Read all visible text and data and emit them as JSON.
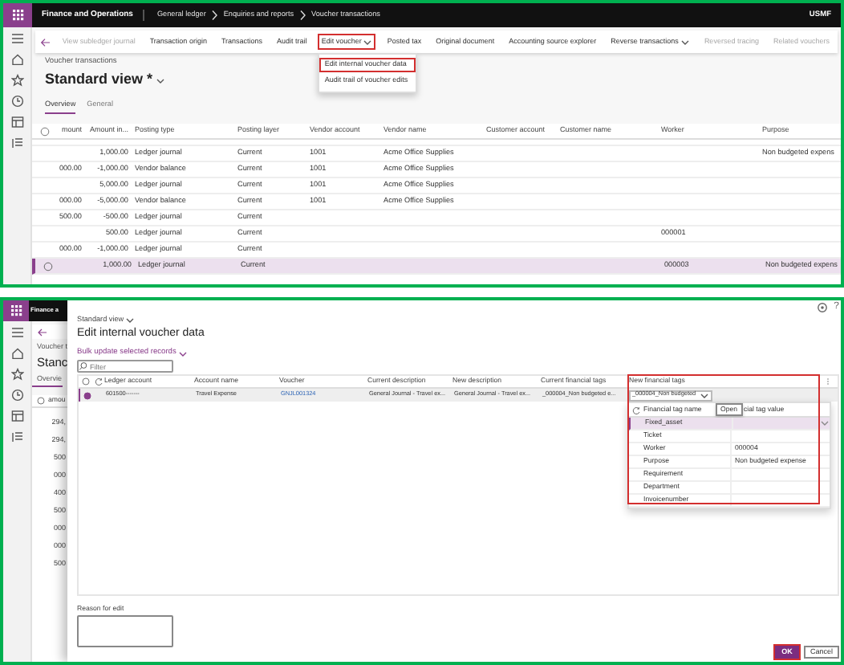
{
  "top_window": {
    "app_title": "Finance and Operations",
    "breadcrumb": [
      "General ledger",
      "Enquiries and reports",
      "Voucher transactions"
    ],
    "company": "USMF",
    "actions": [
      {
        "label": "View subledger journal",
        "disabled": true,
        "dropdown": false,
        "highlighted": false
      },
      {
        "label": "Transaction origin",
        "disabled": false,
        "dropdown": false,
        "highlighted": false
      },
      {
        "label": "Transactions",
        "disabled": false,
        "dropdown": false,
        "highlighted": false
      },
      {
        "label": "Audit trail",
        "disabled": false,
        "dropdown": false,
        "highlighted": false
      },
      {
        "label": "Edit voucher",
        "disabled": false,
        "dropdown": true,
        "highlighted": true,
        "menu": [
          {
            "label": "Edit internal voucher data",
            "highlighted": true
          },
          {
            "label": "Audit trail of voucher edits",
            "highlighted": false
          }
        ]
      },
      {
        "label": "Posted tax",
        "disabled": false,
        "dropdown": false,
        "highlighted": false
      },
      {
        "label": "Original document",
        "disabled": false,
        "dropdown": false,
        "highlighted": false
      },
      {
        "label": "Accounting source explorer",
        "disabled": false,
        "dropdown": false,
        "highlighted": false
      },
      {
        "label": "Reverse transactions",
        "disabled": false,
        "dropdown": true,
        "highlighted": false
      },
      {
        "label": "Reversed tracing",
        "disabled": true,
        "dropdown": false,
        "highlighted": false
      },
      {
        "label": "Related vouchers",
        "disabled": true,
        "dropdown": false,
        "highlighted": false
      }
    ],
    "caption": "Voucher transactions",
    "title": "Standard view *",
    "tabs": [
      {
        "label": "Overview",
        "selected": true
      },
      {
        "label": "General",
        "selected": false
      }
    ],
    "grid": {
      "all_selected": false,
      "columns": [
        {
          "label": "mount",
          "kind": "amount"
        },
        {
          "label": "Amount in...",
          "kind": "amount"
        },
        {
          "label": "Posting type",
          "kind": "text"
        },
        {
          "label": "Posting layer",
          "kind": "text"
        },
        {
          "label": "Vendor account",
          "kind": "text"
        },
        {
          "label": "Vendor name",
          "kind": "text"
        },
        {
          "label": "Customer account",
          "kind": "text"
        },
        {
          "label": "Customer name",
          "kind": "text"
        },
        {
          "label": "Worker",
          "kind": "text"
        },
        {
          "label": "Purpose",
          "kind": "text"
        }
      ],
      "rows": [
        {
          "selected": false,
          "amount_in": "1,000.00",
          "posting_type": "Ledger journal",
          "posting_layer": "Current",
          "vendor_account": "1001",
          "vendor_name": "Acme Office Supplies",
          "purpose": "Non budgeted expens"
        },
        {
          "selected": false,
          "amount": "000.00",
          "amount_in": "-1,000.00",
          "posting_type": "Vendor balance",
          "posting_layer": "Current",
          "vendor_account": "1001",
          "vendor_name": "Acme Office Supplies"
        },
        {
          "selected": false,
          "amount_in": "5,000.00",
          "posting_type": "Ledger journal",
          "posting_layer": "Current",
          "vendor_account": "1001",
          "vendor_name": "Acme Office Supplies"
        },
        {
          "selected": false,
          "amount": "000.00",
          "amount_in": "-5,000.00",
          "posting_type": "Vendor balance",
          "posting_layer": "Current",
          "vendor_account": "1001",
          "vendor_name": "Acme Office Supplies"
        },
        {
          "selected": false,
          "amount": "500.00",
          "amount_in": "-500.00",
          "posting_type": "Ledger journal",
          "posting_layer": "Current"
        },
        {
          "selected": false,
          "amount_in": "500.00",
          "posting_type": "Ledger journal",
          "posting_layer": "Current",
          "worker": "000001"
        },
        {
          "selected": false,
          "amount": "000.00",
          "amount_in": "-1,000.00",
          "posting_type": "Ledger journal",
          "posting_layer": "Current"
        },
        {
          "selected": true,
          "amount_in": "1,000.00",
          "posting_type": "Ledger journal",
          "posting_layer": "Current",
          "worker": "000003",
          "purpose": "Non budgeted expens"
        }
      ]
    }
  },
  "background_page": {
    "app_title": "Finance a",
    "caption": "Voucher t",
    "title": "Stanc",
    "tab": "Overvie",
    "all_selected": false,
    "column": "amou",
    "amounts": [
      "294,",
      "294,",
      "500",
      "000",
      "400",
      "500",
      "000",
      "000",
      "500"
    ]
  },
  "dialog": {
    "help": "?",
    "view": "Standard view",
    "title": "Edit internal voucher data",
    "bulk_action": "Bulk update selected records",
    "filter": {
      "placeholder": "Filter"
    },
    "all_selected": false,
    "columns": [
      {
        "label": "Ledger account",
        "kind": "text"
      },
      {
        "label": "Account name",
        "kind": "text"
      },
      {
        "label": "Voucher",
        "kind": "link"
      },
      {
        "label": "Current description",
        "kind": "text"
      },
      {
        "label": "New description",
        "kind": "text"
      },
      {
        "label": "Current financial tags",
        "kind": "text"
      },
      {
        "label": "New financial tags",
        "kind": "dropdown"
      }
    ],
    "highlight_tags_column": true,
    "rows": [
      {
        "selected": true,
        "ledger_account": "601500-------",
        "account_name": "Travel Expense",
        "voucher": "GNJL001324",
        "current_description": "General Journal - Travel ex...",
        "new_description": "General Journal - Travel ex...",
        "current_tags": "_000004_Non budgeted e...",
        "new_tags": "_000004_Non budgeted"
      }
    ],
    "tag_picker": {
      "name_header": "Financial tag name",
      "value_header": "cial tag value",
      "tooltip": "Open",
      "rows": [
        {
          "name": "Fixed_asset",
          "selected": true
        },
        {
          "name": "Ticket",
          "selected": false
        },
        {
          "name": "Worker",
          "value": "000004",
          "selected": false
        },
        {
          "name": "Purpose",
          "value": "Non budgeted expense",
          "selected": false
        },
        {
          "name": "Requirement",
          "selected": false
        },
        {
          "name": "Department",
          "selected": false
        },
        {
          "name": "Invoicenumber",
          "selected": false
        }
      ]
    },
    "reason": {
      "label": "Reason for edit"
    },
    "buttons": [
      {
        "label": "OK",
        "kind": "primary",
        "highlighted": true
      },
      {
        "label": "Cancel",
        "kind": "secondary",
        "highlighted": false
      }
    ]
  }
}
